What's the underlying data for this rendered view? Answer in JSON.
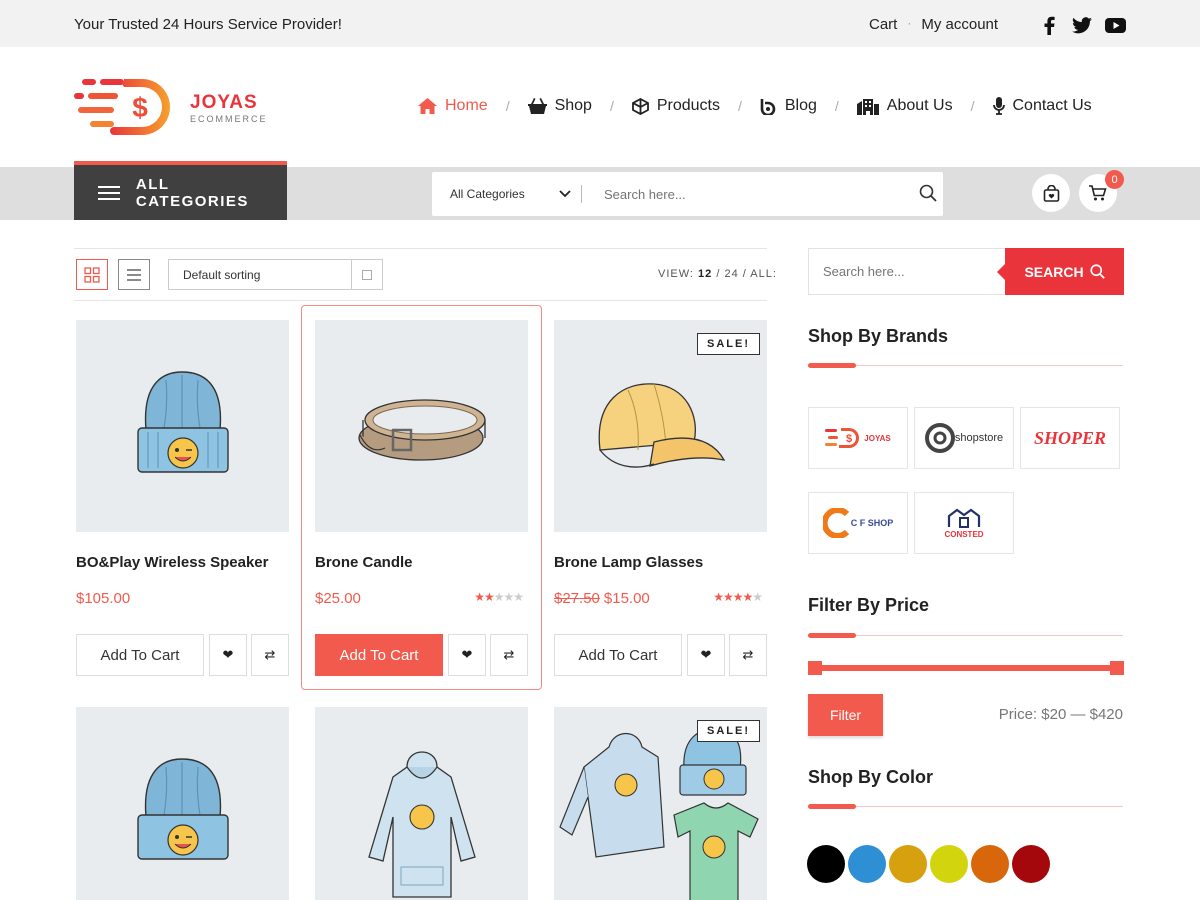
{
  "topbar": {
    "tagline": "Your Trusted 24 Hours Service Provider!",
    "cart": "Cart",
    "separator": "·",
    "account": "My account",
    "social": [
      "facebook-icon",
      "twitter-icon",
      "youtube-icon"
    ]
  },
  "logo": {
    "name": "JOYAS",
    "sub": "ECOMMERCE"
  },
  "nav": {
    "items": [
      {
        "label": "Home",
        "icon": "home-icon",
        "active": true
      },
      {
        "label": "Shop",
        "icon": "basket-icon"
      },
      {
        "label": "Products",
        "icon": "cube-icon"
      },
      {
        "label": "Blog",
        "icon": "blog-icon"
      },
      {
        "label": "About Us",
        "icon": "building-icon"
      },
      {
        "label": "Contact Us",
        "icon": "microphone-icon"
      }
    ],
    "separator": "/"
  },
  "catbar": {
    "all_categories": "ALL CATEGORIES",
    "search_category": "All Categories",
    "search_placeholder": "Search here...",
    "cart_count": "0"
  },
  "toolbar": {
    "sort": "Default sorting",
    "view_label": "VIEW:",
    "view_12": "12",
    "view_rest": "/ 24 / ALL:"
  },
  "products": [
    {
      "title": "BO&Play Wireless Speaker",
      "price": "$105.00",
      "old_price": "",
      "rating": 0,
      "sale": false,
      "add_label": "Add To Cart",
      "image": "beanie"
    },
    {
      "title": "Brone Candle",
      "price": "$25.00",
      "old_price": "",
      "rating": 2,
      "sale": false,
      "add_label": "Add To Cart",
      "image": "belt"
    },
    {
      "title": "Brone Lamp Glasses",
      "price": "$15.00",
      "old_price": "$27.50",
      "rating": 4,
      "sale": true,
      "add_label": "Add To Cart",
      "image": "cap"
    },
    {
      "image": "beanie",
      "sale": false
    },
    {
      "image": "hoodie",
      "sale": false
    },
    {
      "image": "bundle",
      "sale": true
    }
  ],
  "sale_label": "SALE!",
  "sidebar": {
    "search_placeholder": "Search here...",
    "search_button": "SEARCH",
    "brands_title": "Shop By Brands",
    "brands": [
      "JOYAS",
      "shopstore",
      "SHOPER",
      "C F SHOP",
      "CONSTED"
    ],
    "price_title": "Filter By Price",
    "filter_button": "Filter",
    "price_label": "Price: $20 — $420",
    "color_title": "Shop By Color",
    "colors": [
      "#000000",
      "#2f8fd5",
      "#d6a00e",
      "#d2d40d",
      "#d8670c",
      "#a5080c"
    ]
  },
  "accent_color": "#f15a4d"
}
